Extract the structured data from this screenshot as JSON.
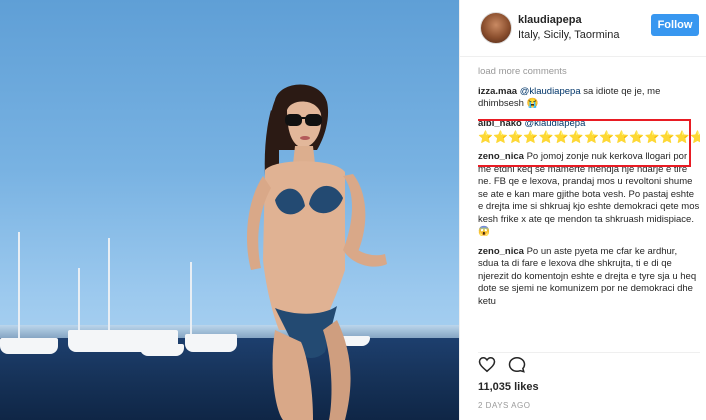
{
  "post": {
    "username": "klaudiapepa",
    "location": "Italy, Sicily, Taormina",
    "follow_label": "Follow"
  },
  "comments": {
    "load_more": "load more comments",
    "items": [
      {
        "user": "izza.maa",
        "mention": "@klaudiapepa",
        "text": " sa idiote qe je, me dhimbsesh 😭"
      },
      {
        "user": "albi_nako",
        "mention": "@klaudiapepa",
        "text": "⭐⭐⭐⭐⭐⭐⭐⭐⭐⭐⭐⭐⭐⭐⭐⭐⭐⭐⭐⭐⭐⭐⭐⭐⭐⭐"
      },
      {
        "user": "zeno_nica",
        "mention": "",
        "text": " Po jomoj zonje nuk kerkova llogari por me etdhi keq se mamerte mendja nje ndarje e tire ne. FB qe e lexova, prandaj mos u revoltoni shume se ate e kan mare gjithe bota vesh. Po pastaj eshte e drejta ime si shkruaj kjo eshte demokraci qete mos kesh frike x ate qe mendon ta shkruash midispiace. 😱"
      },
      {
        "user": "zeno_nica",
        "mention": "",
        "text": " Po un aste pyeta me cfar ke ardhur, sdua ta di fare e lexova dhe shkrujta, ti e di qe njerezit do komentojn eshte e drejta e tyre sja u heq dote se sjemi ne komunizem por ne demokraci dhe ketu"
      }
    ]
  },
  "likes": "11,035 likes",
  "timestamp": "2 DAYS AGO",
  "colors": {
    "accent": "#3897f0",
    "highlight": "#e81b23"
  },
  "icons": [
    "heart-icon",
    "comment-icon"
  ]
}
